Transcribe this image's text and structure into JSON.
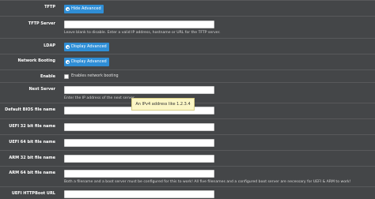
{
  "tftp": {
    "label": "TFTP",
    "button_label": "Hide Advanced"
  },
  "tftp_server": {
    "label": "TFTP Server",
    "help": "Leave blank to disable. Enter a valid IP address, hostname or URL for the TFTP server."
  },
  "ldap": {
    "label": "LDAP",
    "button_label": "Display Advanced"
  },
  "network_booting": {
    "label": "Network Booting",
    "button_label": "Display Advanced"
  },
  "enable": {
    "label": "Enable",
    "checkbox_label": "Enables network booting"
  },
  "next_server": {
    "label": "Next Server",
    "help": "Enter the IP address of the next server",
    "tooltip": "An IPv4 address like 1.2.3.4"
  },
  "default_bios": {
    "label": "Default BIOS file name"
  },
  "uefi32": {
    "label": "UEFI 32 bit file name"
  },
  "uefi64": {
    "label": "UEFI 64 bit file name"
  },
  "arm32": {
    "label": "ARM 32 bit file name"
  },
  "arm64": {
    "label": "ARM 64 bit file name",
    "help": "Both a filename and a boot server must be configured for this to work! All five filenames and a configured boot server are necessary for UEFI & ARM to work!"
  },
  "uefi_httpboot": {
    "label": "UEFI HTTPBoot URL"
  }
}
